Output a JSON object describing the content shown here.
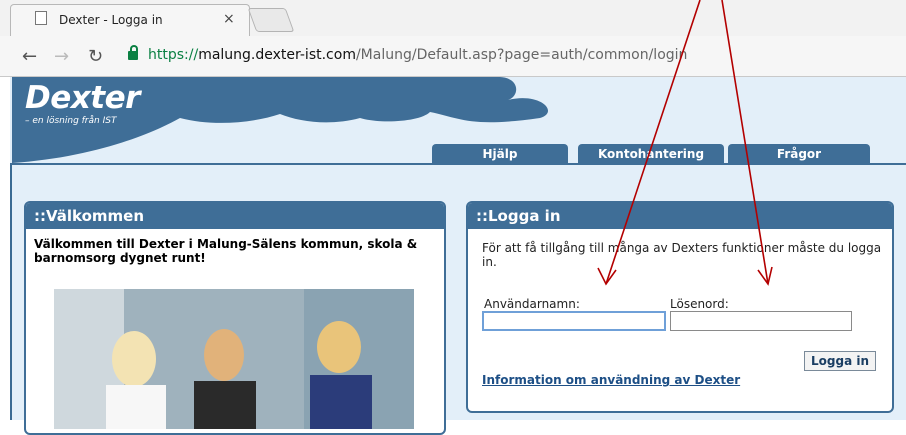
{
  "browser": {
    "tab_title": "Dexter - Logga in",
    "url_proto": "https://",
    "url_host": "malung.dexter-ist.com",
    "url_path": "/Malung/Default.asp?page=auth/common/login"
  },
  "header": {
    "logo": "Dexter",
    "slogan": "– en lösning från IST",
    "tabs": [
      "Hjälp",
      "Kontohantering",
      "Frågor"
    ]
  },
  "welcome": {
    "title": "::Välkommen",
    "text": "Välkommen till Dexter i Malung-Sälens kommun, skola & barnomsorg dygnet runt!"
  },
  "login": {
    "title": "::Logga in",
    "intro": "För att få tillgång till många av Dexters funktioner måste du logga in.",
    "username_label": "Användarnamn:",
    "password_label": "Lösenord:",
    "username_value": "",
    "password_value": "",
    "button": "Logga in",
    "info_link": "Information om användning av Dexter"
  },
  "colors": {
    "accent": "#3f6e97",
    "background": "#e3eff9",
    "annotation": "#b30000"
  }
}
